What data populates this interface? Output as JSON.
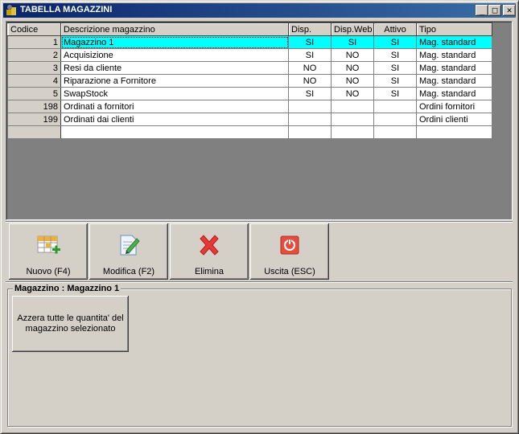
{
  "window": {
    "title": "TABELLA MAGAZZINI",
    "min_label": "_",
    "max_label": "□",
    "close_label": "✕"
  },
  "grid": {
    "headers": [
      "Codice",
      "Descrizione magazzino",
      "Disp.",
      "Disp.Web",
      "Attivo",
      "Tipo"
    ],
    "rows": [
      {
        "codice": "1",
        "descrizione": "Magazzino 1",
        "disp": "SI",
        "disp_web": "SI",
        "attivo": "SI",
        "tipo": "Mag. standard"
      },
      {
        "codice": "2",
        "descrizione": "Acquisizione",
        "disp": "SI",
        "disp_web": "NO",
        "attivo": "SI",
        "tipo": "Mag. standard"
      },
      {
        "codice": "3",
        "descrizione": "Resi da cliente",
        "disp": "NO",
        "disp_web": "NO",
        "attivo": "SI",
        "tipo": "Mag. standard"
      },
      {
        "codice": "4",
        "descrizione": "Riparazione a Fornitore",
        "disp": "NO",
        "disp_web": "NO",
        "attivo": "SI",
        "tipo": "Mag. standard"
      },
      {
        "codice": "5",
        "descrizione": "SwapStock",
        "disp": "SI",
        "disp_web": "NO",
        "attivo": "SI",
        "tipo": "Mag. standard"
      },
      {
        "codice": "198",
        "descrizione": "Ordinati a fornitori",
        "disp": "",
        "disp_web": "",
        "attivo": "",
        "tipo": "Ordini fornitori"
      },
      {
        "codice": "199",
        "descrizione": "Ordinati dai clienti",
        "disp": "",
        "disp_web": "",
        "attivo": "",
        "tipo": "Ordini clienti"
      }
    ],
    "selected_index": 0,
    "selection_color": "#00ffff"
  },
  "toolbar": {
    "nuovo_label": "Nuovo (F4)",
    "modifica_label": "Modifica (F2)",
    "elimina_label": "Elimina",
    "uscita_label": "Uscita (ESC)"
  },
  "group": {
    "legend": "Magazzino : Magazzino 1",
    "reset_label": "Azzera tutte le quantita' del magazzino selezionato"
  }
}
